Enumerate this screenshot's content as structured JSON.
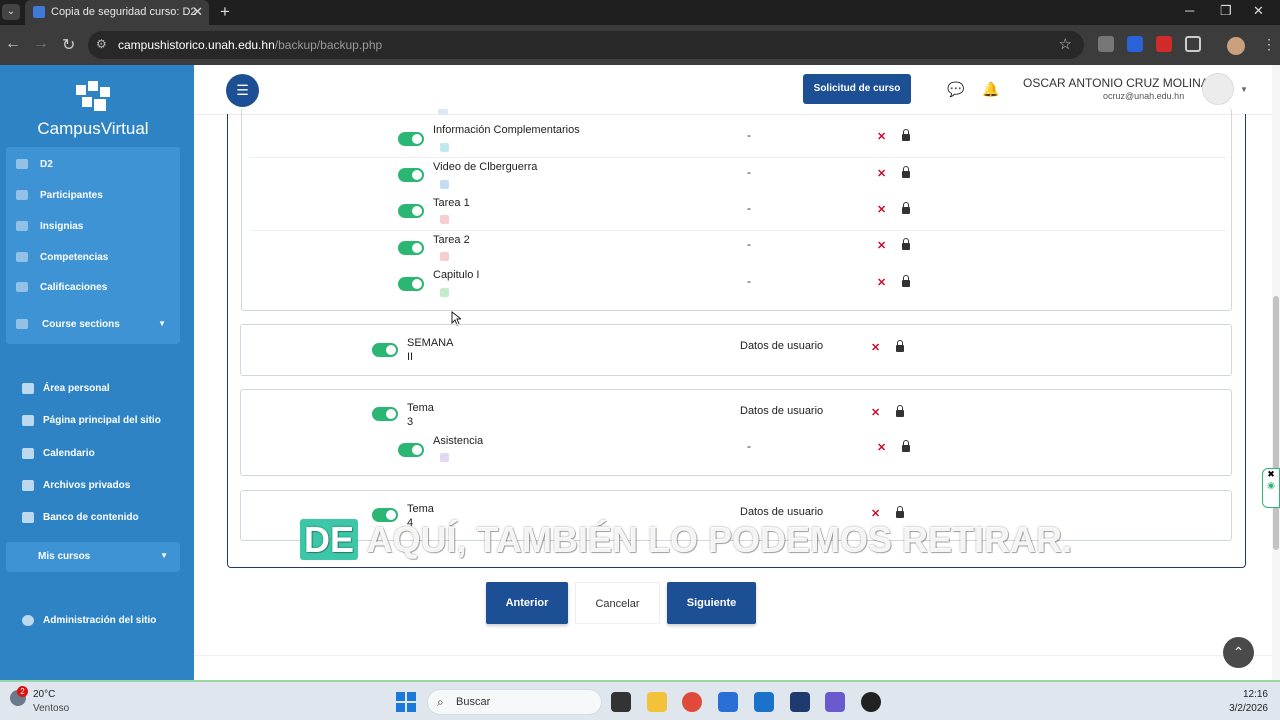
{
  "browser": {
    "tab_title": "Copia de seguridad curso: D2",
    "url_host": "campushistorico.unah.edu.hn",
    "url_path": "/backup/backup.php"
  },
  "sidebar": {
    "logo_text": "CampusVirtual",
    "course_nav": [
      {
        "label": "D2",
        "icon": "graduation-cap-icon"
      },
      {
        "label": "Participantes",
        "icon": "users-icon"
      },
      {
        "label": "Insignias",
        "icon": "trophy-icon"
      },
      {
        "label": "Competencias",
        "icon": "check-icon"
      },
      {
        "label": "Calificaciones",
        "icon": "folder-icon"
      },
      {
        "label": "Course sections",
        "icon": "list-icon"
      }
    ],
    "site_nav": [
      {
        "label": "Área personal",
        "icon": "dashboard-icon"
      },
      {
        "label": "Página principal del sitio",
        "icon": "home-icon"
      },
      {
        "label": "Calendario",
        "icon": "calendar-icon"
      },
      {
        "label": "Archivos privados",
        "icon": "file-icon"
      },
      {
        "label": "Banco de contenido",
        "icon": "content-bank-icon"
      }
    ],
    "mis_cursos": "Mis cursos",
    "admin": "Administración del sitio"
  },
  "header": {
    "solicitud_label": "Solicitud de curso",
    "user_name": "OSCAR ANTONIO CRUZ MOLINA",
    "user_email": "ocruz@unah.edu.hn"
  },
  "activities_top": [
    {
      "name": "Información Complementarios",
      "dash": "-",
      "icon_color": "#7fd3e6"
    },
    {
      "name": "Video de Clberguerra",
      "dash": "-",
      "icon_color": "#8ab8e8"
    },
    {
      "name": "Tarea 1",
      "dash": "-",
      "icon_color": "#f0a2a8"
    },
    {
      "name": "Tarea 2",
      "dash": "-",
      "icon_color": "#f0a2a8"
    },
    {
      "name": "Capitulo I",
      "dash": "-",
      "icon_color": "#8fd49a"
    }
  ],
  "sections": [
    {
      "title_line1": "SEMANA",
      "title_line2": "II",
      "datos": "Datos de usuario"
    },
    {
      "title_line1": "Tema",
      "title_line2": "3",
      "datos": "Datos de usuario",
      "activity": {
        "name": "Asistencia",
        "dash": "-",
        "icon_color": "#c9b8ef"
      }
    },
    {
      "title_line1": "Tema",
      "title_line2": "4",
      "datos": "Datos de usuario"
    }
  ],
  "buttons": {
    "anterior": "Anterior",
    "cancelar": "Cancelar",
    "siguiente": "Siguiente"
  },
  "caption": {
    "highlight": "DE",
    "rest": " AQUÍ, TAMBIÉN LO PODEMOS RETIRAR."
  },
  "taskbar": {
    "temperature": "20°C",
    "weather": "Ventoso",
    "weather_badge": "2",
    "search_placeholder": "Buscar",
    "time": "12:16",
    "date": "3/2/2026"
  },
  "colors": {
    "primary": "#1d4f94",
    "sidebar": "#2e83c5",
    "toggle_on": "#2bb673",
    "remove_x": "#c8102e"
  }
}
